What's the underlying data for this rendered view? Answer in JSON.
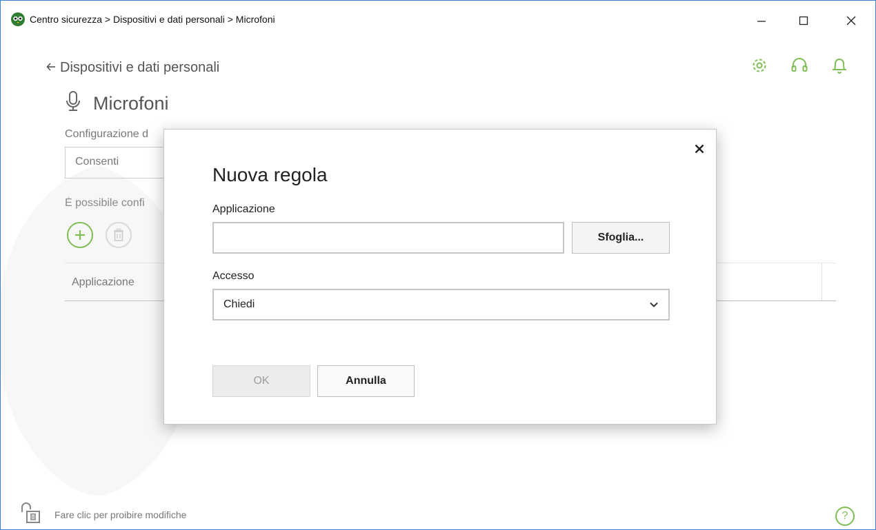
{
  "window": {
    "breadcrumb_title": "Centro sicurezza > Dispositivi e dati personali > Microfoni",
    "logo_icon": "owl-logo-icon"
  },
  "header": {
    "back_label": "Dispositivi e dati personali",
    "icons": [
      "gear-icon",
      "headset-icon",
      "bell-icon"
    ]
  },
  "section": {
    "title": "Microfoni",
    "icon": "microphone-icon",
    "config_label": "Configurazione d",
    "config_value": "Consenti",
    "hint_text": "È possibile confi",
    "table_header": "Applicazione"
  },
  "footer": {
    "lock_text": "Fare clic per proibire modifiche",
    "help_symbol": "?"
  },
  "dialog": {
    "title": "Nuova regola",
    "application_label": "Applicazione",
    "application_value": "",
    "browse_label": "Sfoglia...",
    "access_label": "Accesso",
    "access_value": "Chiedi",
    "ok_label": "OK",
    "cancel_label": "Annulla",
    "ok_enabled": false
  },
  "colors": {
    "accent_green": "#7dbf55",
    "window_border": "#3a7fd5"
  }
}
